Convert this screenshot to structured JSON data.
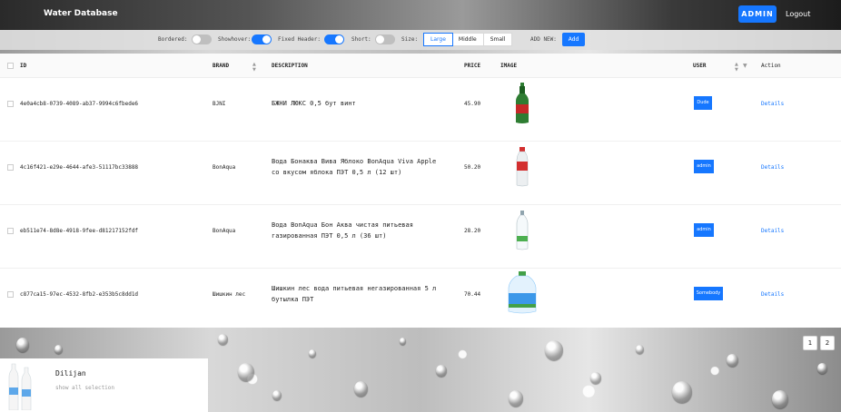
{
  "header": {
    "app_title": "Water Database",
    "admin_label": "ADMIN",
    "logout_label": "Logout"
  },
  "toolbar": {
    "bordered_label": "Bordered:",
    "bordered_on": false,
    "showhover_label": "Showhover:",
    "showhover_on": true,
    "fixed_header_label": "Fixed Header:",
    "fixed_header_on": true,
    "short_label": "Short:",
    "short_on": false,
    "size_label": "Size:",
    "size_options": [
      "Large",
      "Middle",
      "Small"
    ],
    "size_selected": "Large",
    "add_new_label": "ADD NEW:",
    "add_button": "Add"
  },
  "table": {
    "columns": {
      "id": "ID",
      "brand": "BRAND",
      "description": "DESCRIPTION",
      "price": "PRICE",
      "image": "IMAGE",
      "user": "USER",
      "action": "Action"
    },
    "rows": [
      {
        "id": "4e0a4cb8-0739-4089-ab37-9994c6fbede6",
        "brand": "BJNI",
        "description": "БЖНИ ЛЮКС 0,5 бут винт",
        "price": "45.90",
        "user": "Dude",
        "action": "Details",
        "image_icon": "green-bottle-icon"
      },
      {
        "id": "4c16f421-e29e-4644-afe3-51117bc33888",
        "brand": "BonAqua",
        "description": "Вода Бонаква Вива Яблоко BonAqua Viva Apple со вкусом яблока ПЭТ 0,5 л (12 шт)",
        "price": "50.20",
        "user": "admin",
        "action": "Details",
        "image_icon": "red-cap-bottle-icon"
      },
      {
        "id": "eb511e74-8d8e-4918-9fee-d81217152fdf",
        "brand": "BonAqua",
        "description": "Вода BonAqua Бон Аква чистая питьевая газированная ПЭТ 0,5 л (36 шт)",
        "price": "28.20",
        "user": "admin",
        "action": "Details",
        "image_icon": "clear-bottle-icon"
      },
      {
        "id": "c877ca15-97ec-4532-8fb2-e353b5c8dd1d",
        "brand": "Шишкин лес",
        "description": "Шишкин лес вода питьевая негазированная 5 л бутылка ПЭТ",
        "price": "70.44",
        "user": "Somebody",
        "action": "Details",
        "image_icon": "large-jug-icon"
      }
    ]
  },
  "pagination": {
    "pages": [
      "1",
      "2"
    ]
  },
  "selection_card": {
    "title": "Dilijan",
    "subtitle": "show all selection"
  },
  "colors": {
    "accent": "#1677ff",
    "header_dark": "#2a2a2a"
  }
}
